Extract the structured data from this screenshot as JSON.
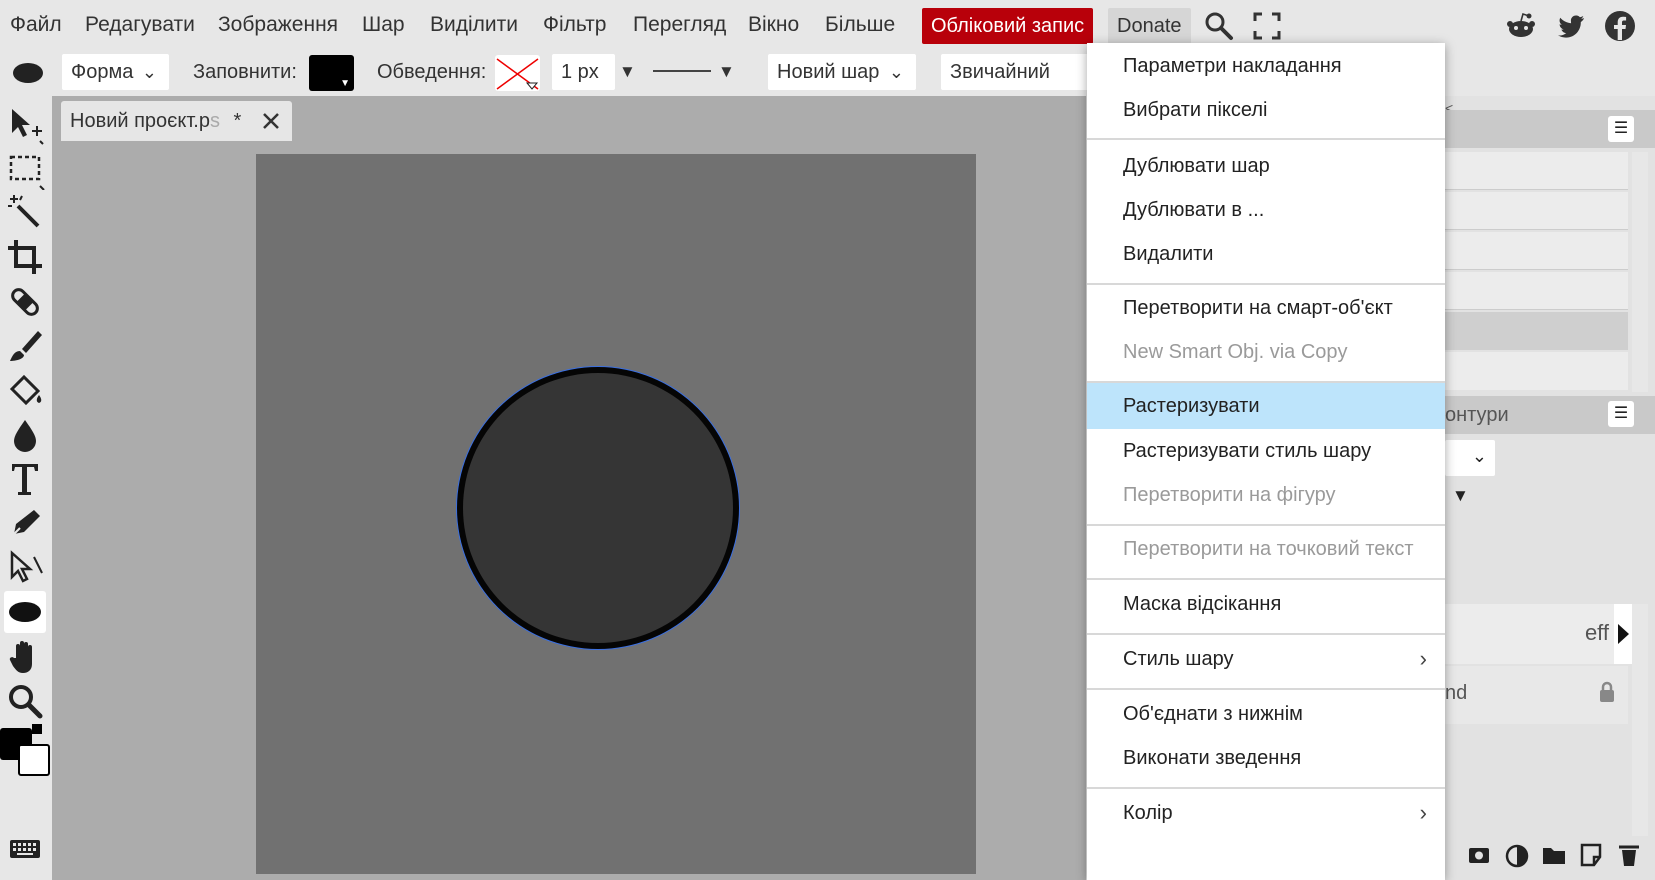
{
  "menubar": {
    "items": [
      "Файл",
      "Редагувати",
      "Зображення",
      "Шар",
      "Виділити",
      "Фільтр",
      "Перегляд",
      "Вікно",
      "Більше"
    ],
    "account": "Обліковий запис",
    "donate": "Donate"
  },
  "toolbar": {
    "shape_mode": "Форма",
    "fill_label": "Заповнити:",
    "stroke_label": "Обведення:",
    "stroke_width": "1 px",
    "layer_mode": "Новий шар",
    "blend_mode": "Звичайний"
  },
  "document": {
    "tab_title": "Новий проєкт.p",
    "tab_title_fade": "s",
    "modified": "*"
  },
  "right_panel": {
    "paths_tab_fragment": "онтури",
    "layer_fragment": "eff",
    "layer_name_fragment": "nd"
  },
  "context_menu": {
    "items": [
      {
        "label": "Параметри накладання",
        "disabled": false
      },
      {
        "label": "Вибрати пікселі",
        "disabled": false
      },
      {
        "label": "Дублювати шар",
        "disabled": false
      },
      {
        "label": "Дублювати в ...",
        "disabled": false
      },
      {
        "label": "Видалити",
        "disabled": false
      },
      {
        "label": "Перетворити на смарт-об'єкт",
        "disabled": false
      },
      {
        "label": "New Smart Obj. via Copy",
        "disabled": true
      },
      {
        "label": "Растеризувати",
        "disabled": false,
        "highlighted": true
      },
      {
        "label": "Растеризувати стиль шару",
        "disabled": false
      },
      {
        "label": "Перетворити на фігуру",
        "disabled": true
      },
      {
        "label": "Перетворити на точковий текст",
        "disabled": true
      },
      {
        "label": "Маска відсікання",
        "disabled": false
      },
      {
        "label": "Стиль шару",
        "disabled": false,
        "submenu": true
      },
      {
        "label": "Об'єднати з нижнім",
        "disabled": false
      },
      {
        "label": "Виконати зведення",
        "disabled": false
      },
      {
        "label": "Колір",
        "disabled": false,
        "submenu": true
      }
    ]
  },
  "colors": {
    "accent_red": "#b8000a",
    "highlight": "#bde4fb",
    "canvas": "#717171",
    "shape_fill": "#353535",
    "selection_outline": "#3b6fe0"
  }
}
